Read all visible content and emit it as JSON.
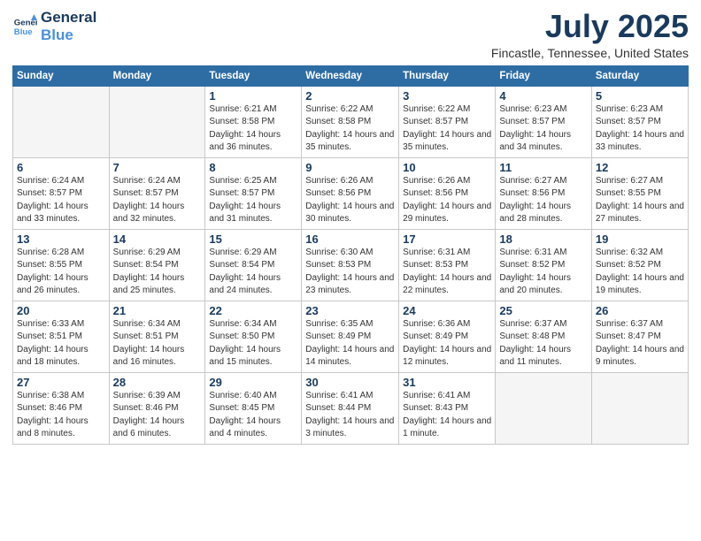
{
  "header": {
    "logo_line1": "General",
    "logo_line2": "Blue",
    "main_title": "July 2025",
    "sub_title": "Fincastle, Tennessee, United States"
  },
  "calendar": {
    "days_of_week": [
      "Sunday",
      "Monday",
      "Tuesday",
      "Wednesday",
      "Thursday",
      "Friday",
      "Saturday"
    ],
    "weeks": [
      [
        {
          "day": "",
          "empty": true
        },
        {
          "day": "",
          "empty": true
        },
        {
          "day": "1",
          "sunrise": "6:21 AM",
          "sunset": "8:58 PM",
          "daylight": "14 hours and 36 minutes."
        },
        {
          "day": "2",
          "sunrise": "6:22 AM",
          "sunset": "8:58 PM",
          "daylight": "14 hours and 35 minutes."
        },
        {
          "day": "3",
          "sunrise": "6:22 AM",
          "sunset": "8:57 PM",
          "daylight": "14 hours and 35 minutes."
        },
        {
          "day": "4",
          "sunrise": "6:23 AM",
          "sunset": "8:57 PM",
          "daylight": "14 hours and 34 minutes."
        },
        {
          "day": "5",
          "sunrise": "6:23 AM",
          "sunset": "8:57 PM",
          "daylight": "14 hours and 33 minutes."
        }
      ],
      [
        {
          "day": "6",
          "sunrise": "6:24 AM",
          "sunset": "8:57 PM",
          "daylight": "14 hours and 33 minutes."
        },
        {
          "day": "7",
          "sunrise": "6:24 AM",
          "sunset": "8:57 PM",
          "daylight": "14 hours and 32 minutes."
        },
        {
          "day": "8",
          "sunrise": "6:25 AM",
          "sunset": "8:57 PM",
          "daylight": "14 hours and 31 minutes."
        },
        {
          "day": "9",
          "sunrise": "6:26 AM",
          "sunset": "8:56 PM",
          "daylight": "14 hours and 30 minutes."
        },
        {
          "day": "10",
          "sunrise": "6:26 AM",
          "sunset": "8:56 PM",
          "daylight": "14 hours and 29 minutes."
        },
        {
          "day": "11",
          "sunrise": "6:27 AM",
          "sunset": "8:56 PM",
          "daylight": "14 hours and 28 minutes."
        },
        {
          "day": "12",
          "sunrise": "6:27 AM",
          "sunset": "8:55 PM",
          "daylight": "14 hours and 27 minutes."
        }
      ],
      [
        {
          "day": "13",
          "sunrise": "6:28 AM",
          "sunset": "8:55 PM",
          "daylight": "14 hours and 26 minutes."
        },
        {
          "day": "14",
          "sunrise": "6:29 AM",
          "sunset": "8:54 PM",
          "daylight": "14 hours and 25 minutes."
        },
        {
          "day": "15",
          "sunrise": "6:29 AM",
          "sunset": "8:54 PM",
          "daylight": "14 hours and 24 minutes."
        },
        {
          "day": "16",
          "sunrise": "6:30 AM",
          "sunset": "8:53 PM",
          "daylight": "14 hours and 23 minutes."
        },
        {
          "day": "17",
          "sunrise": "6:31 AM",
          "sunset": "8:53 PM",
          "daylight": "14 hours and 22 minutes."
        },
        {
          "day": "18",
          "sunrise": "6:31 AM",
          "sunset": "8:52 PM",
          "daylight": "14 hours and 20 minutes."
        },
        {
          "day": "19",
          "sunrise": "6:32 AM",
          "sunset": "8:52 PM",
          "daylight": "14 hours and 19 minutes."
        }
      ],
      [
        {
          "day": "20",
          "sunrise": "6:33 AM",
          "sunset": "8:51 PM",
          "daylight": "14 hours and 18 minutes."
        },
        {
          "day": "21",
          "sunrise": "6:34 AM",
          "sunset": "8:51 PM",
          "daylight": "14 hours and 16 minutes."
        },
        {
          "day": "22",
          "sunrise": "6:34 AM",
          "sunset": "8:50 PM",
          "daylight": "14 hours and 15 minutes."
        },
        {
          "day": "23",
          "sunrise": "6:35 AM",
          "sunset": "8:49 PM",
          "daylight": "14 hours and 14 minutes."
        },
        {
          "day": "24",
          "sunrise": "6:36 AM",
          "sunset": "8:49 PM",
          "daylight": "14 hours and 12 minutes."
        },
        {
          "day": "25",
          "sunrise": "6:37 AM",
          "sunset": "8:48 PM",
          "daylight": "14 hours and 11 minutes."
        },
        {
          "day": "26",
          "sunrise": "6:37 AM",
          "sunset": "8:47 PM",
          "daylight": "14 hours and 9 minutes."
        }
      ],
      [
        {
          "day": "27",
          "sunrise": "6:38 AM",
          "sunset": "8:46 PM",
          "daylight": "14 hours and 8 minutes."
        },
        {
          "day": "28",
          "sunrise": "6:39 AM",
          "sunset": "8:46 PM",
          "daylight": "14 hours and 6 minutes."
        },
        {
          "day": "29",
          "sunrise": "6:40 AM",
          "sunset": "8:45 PM",
          "daylight": "14 hours and 4 minutes."
        },
        {
          "day": "30",
          "sunrise": "6:41 AM",
          "sunset": "8:44 PM",
          "daylight": "14 hours and 3 minutes."
        },
        {
          "day": "31",
          "sunrise": "6:41 AM",
          "sunset": "8:43 PM",
          "daylight": "14 hours and 1 minute."
        },
        {
          "day": "",
          "empty": true
        },
        {
          "day": "",
          "empty": true
        }
      ]
    ],
    "labels": {
      "sunrise": "Sunrise:",
      "sunset": "Sunset:",
      "daylight": "Daylight:"
    }
  }
}
